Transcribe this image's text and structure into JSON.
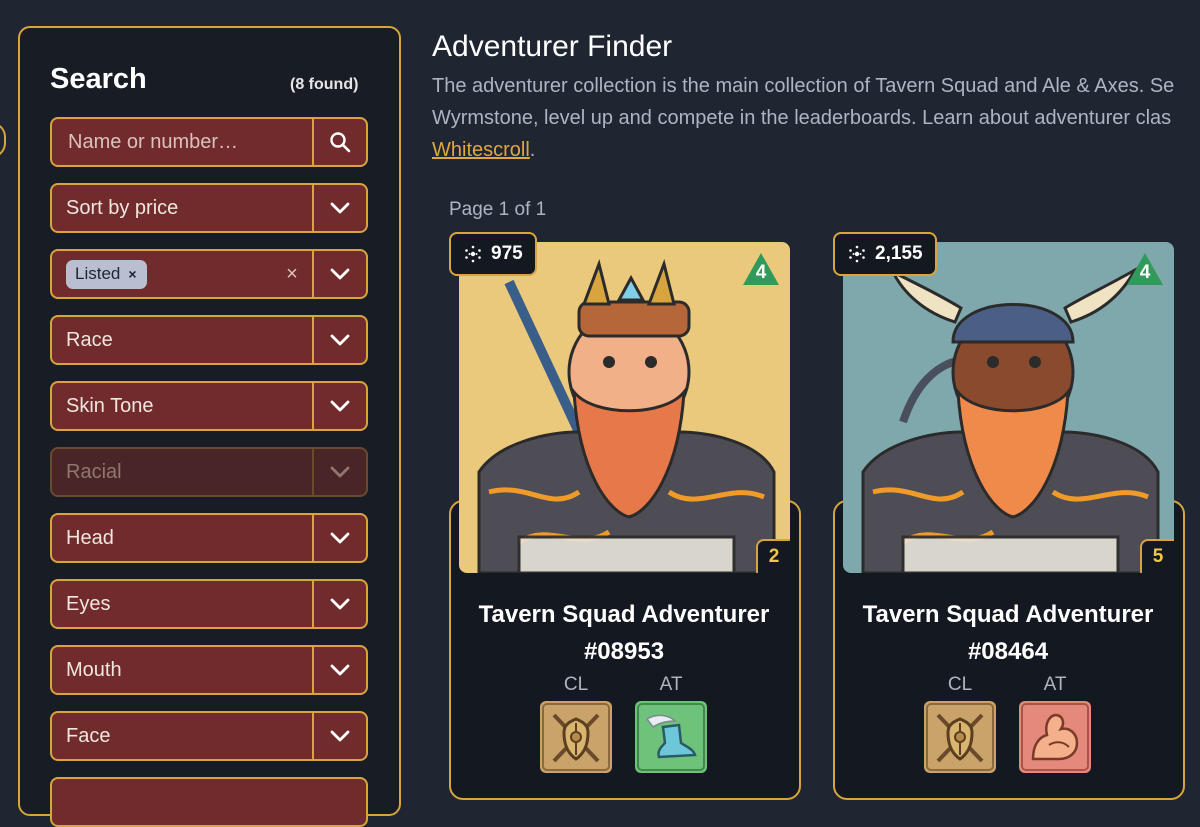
{
  "sidebar": {
    "title": "Search",
    "found": "(8 found)",
    "search": {
      "placeholder": "Name or number…",
      "icon": "search-icon"
    },
    "sort": {
      "label": "Sort by price"
    },
    "status_filter": {
      "chip": "Listed",
      "chip_remove": "×",
      "clear": "×"
    },
    "filters": [
      {
        "label": "Race",
        "disabled": false
      },
      {
        "label": "Skin Tone",
        "disabled": false
      },
      {
        "label": "Racial",
        "disabled": true
      },
      {
        "label": "Head",
        "disabled": false
      },
      {
        "label": "Eyes",
        "disabled": false
      },
      {
        "label": "Mouth",
        "disabled": false
      },
      {
        "label": "Face",
        "disabled": false
      }
    ]
  },
  "main": {
    "title": "Adventurer Finder",
    "description_line1": "The adventurer collection is the main collection of Tavern Squad and Ale & Axes. Se",
    "description_line2": "Wyrmstone, level up and compete in the leaderboards. Learn about adventurer clas",
    "description_link": "Whitescroll",
    "description_end": ".",
    "page_info": "Page 1 of 1"
  },
  "cards": [
    {
      "price": "975",
      "tier": "4",
      "level": "2",
      "name_line1": "Tavern Squad Adventurer",
      "name_line2": "#08953",
      "traits": [
        {
          "label": "CL",
          "icon": "shield-axes-icon"
        },
        {
          "label": "AT",
          "icon": "winged-boot-icon"
        }
      ],
      "bg_color": "#ebc97c"
    },
    {
      "price": "2,155",
      "tier": "4",
      "level": "5",
      "name_line1": "Tavern Squad Adventurer",
      "name_line2": "#08464",
      "traits": [
        {
          "label": "CL",
          "icon": "shield-axes-icon"
        },
        {
          "label": "AT",
          "icon": "flexed-arm-icon"
        }
      ],
      "bg_color": "#7fa8ad"
    }
  ]
}
